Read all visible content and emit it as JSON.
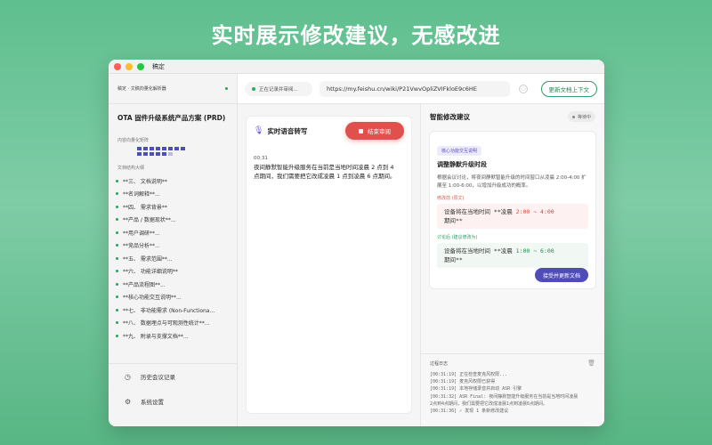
{
  "hero_title": "实时展示修改建议，无感改进",
  "window": {
    "title": "稿定"
  },
  "sidebar": {
    "brand": "稿定 · 文稿向量化解析器",
    "doc_title": "OTA 固件升级系统产品方案 (PRD)",
    "vector_label": "内容向量化矩阵",
    "outline_label": "文档结构大纲",
    "outline": [
      "**三、 文档说明**",
      "**名词解释**...",
      "**四、 需求背景**",
      "**产品 / 数据现状**...",
      "**用户调研**...",
      "**竞品分析**...",
      "**五、 需求范围**...",
      "**六、 功能详细说明**",
      "**产品流程图**...",
      "**核心功能交互说明**...",
      "**七、 非功能需求 (Non-Functiona...",
      "**八、 数据埋点与可观测性统计**...",
      "**九、 附录与支撑文档**..."
    ],
    "history_label": "历史会议记录",
    "settings_label": "系统设置"
  },
  "toolbar": {
    "status": "正在记录并审阅...",
    "url": "https://my.feishu.cn/wiki/P21VwvOpliZVIFkloE9c6HE",
    "update_label": "更新文档上下文"
  },
  "asr": {
    "title": "实时语音转写",
    "end_label": "结束审阅",
    "time": "00:31",
    "text": "夜间静默智能升级服务在当前是当地时间凌晨 2 点到 4 点期间，我们需要把它改成凌晨 1 点到凌晨 6 点期间。"
  },
  "suggestion": {
    "title": "智能修改建议",
    "badge": "等待中",
    "card": {
      "tag": "核心功能交互说明",
      "title": "调整静默升级时段",
      "desc": "根据会议讨论，将夜间静默智能升级的时间窗口从凌晨 2:00-4:00 扩展至 1:00-6:00，以增加升级成功的概率。",
      "before_label": "修改前 (原文)",
      "before_prefix": "设备将在当地时间 **凌晨 ",
      "before_hl": "2:00 ~ 4:00",
      "before_suffix": "期间**",
      "after_label": "讨论后 (建议修改为)",
      "after_prefix": "设备将在当地时间 **凌晨 ",
      "after_hl": "1:00 ~ 6:00",
      "after_suffix": "期间**",
      "accept_label": "接受并更新文档"
    }
  },
  "log": {
    "title": "过程日志",
    "lines": [
      "[00:31:19] 正在检查麦克风权限...",
      "[00:31:19] 麦克风权限已获得",
      "[00:31:19] 本地存储录音并启动 ASR 引擎",
      "[00:31:32] ASR Final: 夜间静默智能升级服务在当前是当地时间凌晨",
      "2点到4点期间，我们需要把它改成凌晨1点到凌晨6点期间。",
      "[00:31:36] ✓ 发现 1 条新修改建议"
    ]
  },
  "colors": {
    "accent_green": "#2f9d63",
    "accent_purple": "#4f4bb8",
    "end_red": "#e0504d"
  }
}
